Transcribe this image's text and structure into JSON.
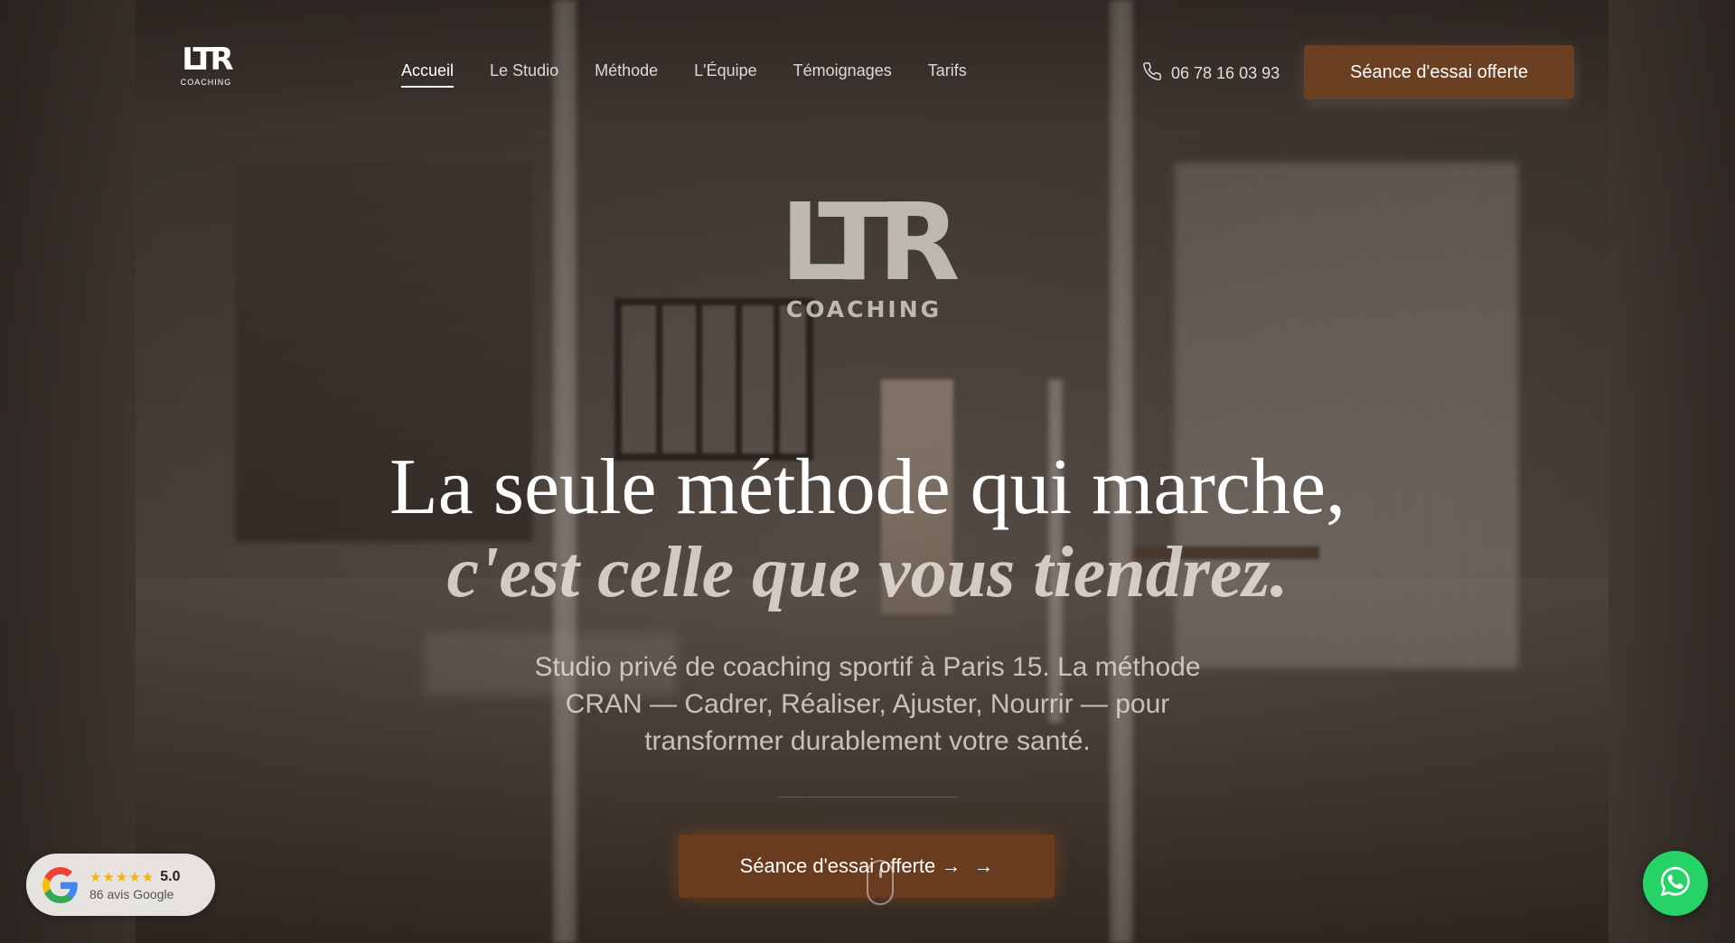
{
  "header": {
    "logo_mark": "LTR",
    "logo_sub": "COACHING",
    "nav": [
      {
        "label": "Accueil",
        "active": true
      },
      {
        "label": "Le Studio",
        "active": false
      },
      {
        "label": "Méthode",
        "active": false
      },
      {
        "label": "L'Équipe",
        "active": false
      },
      {
        "label": "Témoignages",
        "active": false
      },
      {
        "label": "Tarifs",
        "active": false
      }
    ],
    "phone": "06 78 16 03 93",
    "cta_label": "Séance d'essai offerte"
  },
  "hero": {
    "logo_mark": "LTR",
    "logo_sub": "COACHING",
    "headline_line1": "La seule méthode qui marche,",
    "headline_line2": "c'est celle que vous tiendrez.",
    "subtext": "Studio privé de coaching sportif à Paris 15. La méthode CRAN — Cadrer, Réaliser, Ajuster, Nourrir — pour transformer durablement votre santé.",
    "cta_label": "Séance d'essai offerte →",
    "cta_arrow": "→"
  },
  "google_badge": {
    "stars": "★★★★★",
    "score": "5.0",
    "count": "86 avis Google"
  },
  "colors": {
    "brand_brown": "#6b3f22",
    "whatsapp_green": "#25d366",
    "star_gold": "#f5b400"
  },
  "icons": {
    "phone": "phone-icon",
    "google": "google-logo-icon",
    "whatsapp": "whatsapp-icon",
    "arrow": "arrow-right-icon",
    "scroll": "scroll-mouse-icon"
  }
}
